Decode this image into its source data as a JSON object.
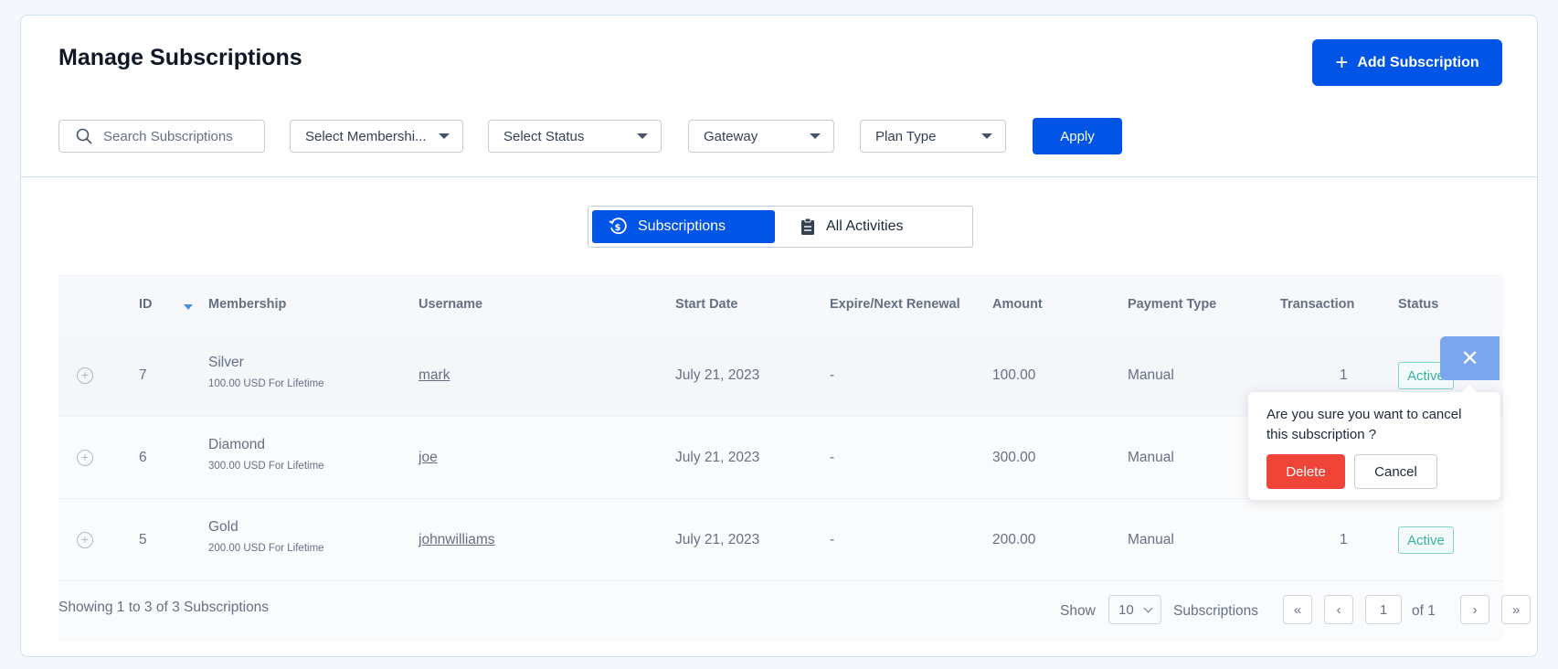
{
  "header": {
    "title": "Manage Subscriptions",
    "add_button": "Add Subscription"
  },
  "filters": {
    "search_placeholder": "Search Subscriptions",
    "membership": "Select Membershi...",
    "status": "Select Status",
    "gateway": "Gateway",
    "plan_type": "Plan Type",
    "apply": "Apply"
  },
  "tabs": [
    {
      "label": "Subscriptions",
      "active": true
    },
    {
      "label": "All Activities",
      "active": false
    }
  ],
  "table": {
    "columns": [
      "ID",
      "Membership",
      "Username",
      "Start Date",
      "Expire/Next Renewal",
      "Amount",
      "Payment Type",
      "Transaction",
      "Status"
    ],
    "rows": [
      {
        "id": "7",
        "membership": "Silver",
        "membership_sub": "100.00 USD For Lifetime",
        "username": "mark",
        "start_date": "July 21, 2023",
        "expire": "-",
        "amount": "100.00",
        "payment_type": "Manual",
        "transaction": "1",
        "status": "Active"
      },
      {
        "id": "6",
        "membership": "Diamond",
        "membership_sub": "300.00 USD For Lifetime",
        "username": "joe",
        "start_date": "July 21, 2023",
        "expire": "-",
        "amount": "300.00",
        "payment_type": "Manual",
        "transaction": "",
        "status": ""
      },
      {
        "id": "5",
        "membership": "Gold",
        "membership_sub": "200.00 USD For Lifetime",
        "username": "johnwilliams",
        "start_date": "July 21, 2023",
        "expire": "-",
        "amount": "200.00",
        "payment_type": "Manual",
        "transaction": "1",
        "status": "Active"
      }
    ]
  },
  "footer": {
    "showing": "Showing 1 to 3 of 3 Subscriptions",
    "show_label": "Show",
    "per_page": "10",
    "subscriptions_label": "Subscriptions",
    "first": "«",
    "prev": "‹",
    "page": "1",
    "of_pages": "of 1",
    "next": "›",
    "last": "»"
  },
  "popover": {
    "close": "✕",
    "message": "Are you sure you want to cancel this subscription ?",
    "delete": "Delete",
    "cancel": "Cancel"
  },
  "colors": {
    "primary": "#0054e6",
    "danger": "#f04438",
    "active_badge": "#38b2a0"
  }
}
